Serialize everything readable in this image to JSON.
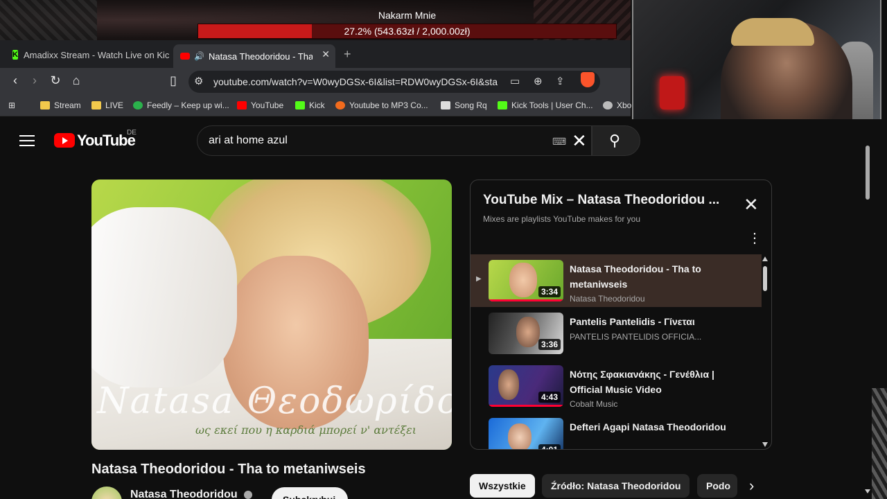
{
  "overlay": {
    "goal_title": "Nakarm Mnie",
    "goal_text": "27.2% (543.63zł / 2,000.00zł)",
    "goal_progress": 0.272
  },
  "browser": {
    "tabs": [
      {
        "label": "Amadixx Stream - Watch Live on Kick",
        "active": false
      },
      {
        "label": "Natasa Theodoridou - Tha to",
        "active": true
      }
    ],
    "url": "youtube.com/watch?v=W0wyDGSx-6I&list=RDW0wyDGSx-6I&sta...",
    "brave_badge": "35",
    "bookmarks": [
      {
        "label": "Stream",
        "icon": "folder-icon"
      },
      {
        "label": "LIVE",
        "icon": "folder-icon"
      },
      {
        "label": "Feedly – Keep up wi...",
        "icon": "feedly-icon"
      },
      {
        "label": "YouTube",
        "icon": "youtube-icon"
      },
      {
        "label": "Kick",
        "icon": "kick-icon"
      },
      {
        "label": "Youtube to MP3 Co...",
        "icon": "mp3-icon"
      },
      {
        "label": "Song Rq",
        "icon": "cart-icon"
      },
      {
        "label": "Kick Tools | User Ch...",
        "icon": "kick-icon"
      },
      {
        "label": "Xbo",
        "icon": "xbox-icon"
      }
    ]
  },
  "youtube": {
    "logo_text": "YouTube",
    "country": "DE",
    "search_value": "ari at home azul",
    "video": {
      "title": "Natasa Theodoridou - Tha to metaniwseis",
      "channel": "Natasa Theodoridou",
      "subscribe_label": "Subskrybuj",
      "art_script": "Natasa Θεοδωρίδου",
      "art_subtitle": "ως εκεί που η καρδιά μπορεί ν' αντέξει"
    },
    "playlist": {
      "title": "YouTube Mix – Natasa Theodoridou ...",
      "subtitle": "Mixes are playlists YouTube makes for you",
      "items": [
        {
          "title": "Natasa Theodoridou - Tha to metaniwseis",
          "channel": "Natasa Theodoridou",
          "duration": "3:34",
          "playing": true
        },
        {
          "title": "Pantelis Pantelidis - Γίνεται",
          "channel": "PANTELIS PANTELIDIS OFFICIA...",
          "duration": "3:36",
          "playing": false
        },
        {
          "title": "Νότης Σφακιανάκης - Γενέθλια | Official Music Video",
          "channel": "Cobalt Music",
          "duration": "4:43",
          "playing": false
        },
        {
          "title": "Defteri Agapi Natasa Theodoridou",
          "channel": "",
          "duration": "4:01",
          "playing": false
        }
      ]
    },
    "chips": [
      {
        "label": "Wszystkie",
        "selected": true
      },
      {
        "label": "Źródło: Natasa Theodoridou",
        "selected": false
      },
      {
        "label": "Podo",
        "selected": false
      }
    ]
  },
  "colors": {
    "accent": "#ff0000",
    "kick": "#53fc18",
    "progress": "#ff0033"
  }
}
